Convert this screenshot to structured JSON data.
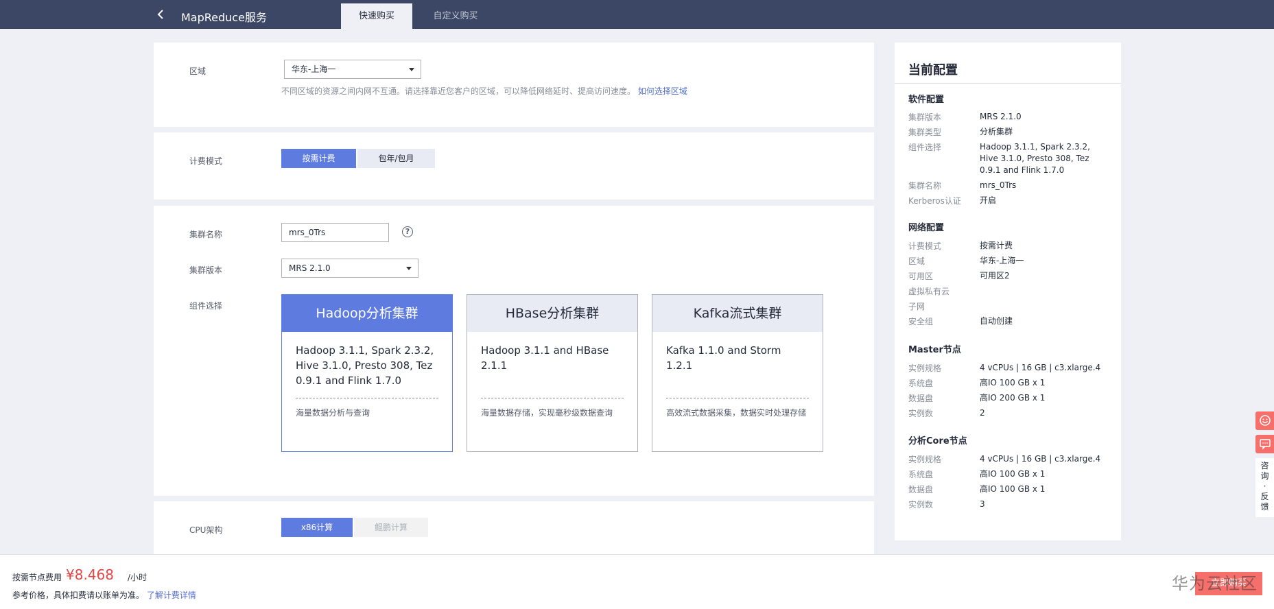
{
  "header": {
    "title": "MapReduce服务",
    "tabs": [
      {
        "label": "快速购买",
        "active": true
      },
      {
        "label": "自定义购买",
        "active": false
      }
    ]
  },
  "region": {
    "label": "区域",
    "value": "华东-上海一",
    "hint": "不同区域的资源之间内网不互通。请选择靠近您客户的区域，可以降低网络延时、提高访问速度。",
    "hint_link": "如何选择区域"
  },
  "billing": {
    "label": "计费模式",
    "options": [
      "按需计费",
      "包年/包月"
    ]
  },
  "cluster": {
    "name_label": "集群名称",
    "name_value": "mrs_0Trs",
    "help_symbol": "?",
    "version_label": "集群版本",
    "version_value": "MRS 2.1.0",
    "component_label": "组件选择",
    "components": [
      {
        "title": "Hadoop分析集群",
        "content": "Hadoop 3.1.1, Spark 2.3.2, Hive 3.1.0, Presto 308, Tez 0.9.1 and Flink 1.7.0",
        "desc": "海量数据分析与查询",
        "selected": true
      },
      {
        "title": "HBase分析集群",
        "content": "Hadoop 3.1.1 and HBase 2.1.1",
        "desc": "海量数据存储，实现毫秒级数据查询",
        "selected": false
      },
      {
        "title": "Kafka流式集群",
        "content": "Kafka 1.1.0 and Storm 1.2.1",
        "desc": "高效流式数据采集，数据实时处理存储",
        "selected": false
      }
    ]
  },
  "cpu": {
    "label": "CPU架构",
    "options": [
      "x86计算",
      "鲲鹏计算"
    ]
  },
  "summary": {
    "title": "当前配置",
    "software": {
      "title": "软件配置",
      "rows": [
        {
          "k": "集群版本",
          "v": "MRS 2.1.0"
        },
        {
          "k": "集群类型",
          "v": "分析集群"
        },
        {
          "k": "组件选择",
          "v": "Hadoop 3.1.1, Spark 2.3.2, Hive 3.1.0, Presto 308, Tez 0.9.1 and Flink 1.7.0"
        },
        {
          "k": "集群名称",
          "v": "mrs_0Trs"
        },
        {
          "k": "Kerberos认证",
          "v": "开启"
        }
      ]
    },
    "network": {
      "title": "网络配置",
      "rows": [
        {
          "k": "计费模式",
          "v": "按需计费"
        },
        {
          "k": "区域",
          "v": "华东-上海一"
        },
        {
          "k": "可用区",
          "v": "可用区2"
        },
        {
          "k": "虚拟私有云",
          "v": ""
        },
        {
          "k": "子网",
          "v": ""
        },
        {
          "k": "安全组",
          "v": "自动创建"
        }
      ]
    },
    "master": {
      "title": "Master节点",
      "rows": [
        {
          "k": "实例规格",
          "v": "4 vCPUs | 16 GB | c3.xlarge.4"
        },
        {
          "k": "系统盘",
          "v": "高IO 100 GB x 1"
        },
        {
          "k": "数据盘",
          "v": "高IO 200 GB x 1"
        },
        {
          "k": "实例数",
          "v": "2"
        }
      ]
    },
    "core": {
      "title": "分析Core节点",
      "rows": [
        {
          "k": "实例规格",
          "v": "4 vCPUs | 16 GB | c3.xlarge.4"
        },
        {
          "k": "系统盘",
          "v": "高IO 100 GB x 1"
        },
        {
          "k": "数据盘",
          "v": "高IO 100 GB x 1"
        },
        {
          "k": "实例数",
          "v": "3"
        }
      ]
    }
  },
  "float": {
    "feedback_text": [
      "咨",
      "询",
      "·",
      "反",
      "馈"
    ]
  },
  "footer": {
    "fee_label": "按需节点费用",
    "price": "¥8.468",
    "unit": "/小时",
    "note": "参考价格，具体扣费请以账单为准。",
    "note_link": "了解计费详情",
    "buy_label": "立即购买",
    "watermark": "华为云社区"
  },
  "colors": {
    "topbar": "#3c4766",
    "primary": "#5e7ce0",
    "price": "#e54545",
    "buy": "#f66f6a"
  }
}
